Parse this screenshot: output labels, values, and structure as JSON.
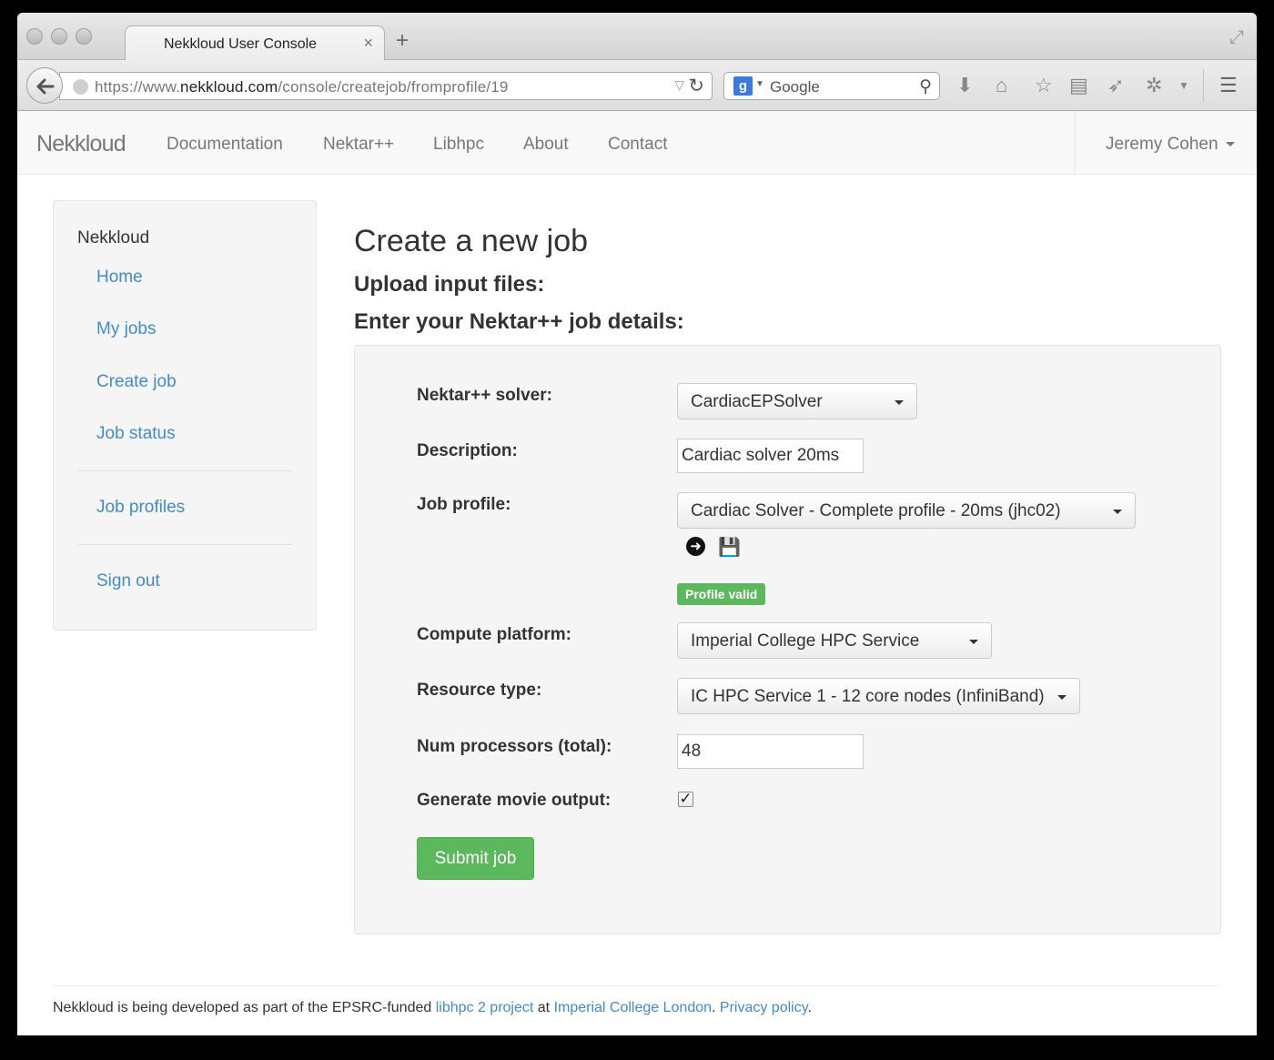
{
  "browser": {
    "tab_title": "Nekkloud User Console",
    "tab_close": "×",
    "new_tab": "+",
    "url_prefix": "https://www.",
    "url_domain": "nekkloud.com",
    "url_path": "/console/createjob/fromprofile/19",
    "search_engine_letter": "g",
    "search_placeholder": "Google"
  },
  "navbar": {
    "brand": "Nekkloud",
    "links": [
      "Documentation",
      "Nektar++",
      "Libhpc",
      "About",
      "Contact"
    ],
    "user": "Jeremy Cohen"
  },
  "sidebar": {
    "header": "Nekkloud",
    "items": [
      "Home",
      "My jobs",
      "Create job",
      "Job status",
      "Job profiles",
      "Sign out"
    ]
  },
  "main": {
    "title": "Create a new job",
    "upload_heading": "Upload input files:",
    "details_heading": "Enter your Nektar++ job details:",
    "form": {
      "solver_label": "Nektar++ solver:",
      "solver_value": "CardiacEPSolver",
      "description_label": "Description:",
      "description_value": "Cardiac solver 20ms",
      "profile_label": "Job profile:",
      "profile_value": "Cardiac Solver - Complete profile - 20ms (jhc02)",
      "profile_status": "Profile valid",
      "platform_label": "Compute platform:",
      "platform_value": "Imperial College HPC Service",
      "resource_label": "Resource type:",
      "resource_value": "IC HPC Service 1 - 12 core nodes (InfiniBand)",
      "processors_label": "Num processors (total):",
      "processors_value": "48",
      "movie_label": "Generate movie output:",
      "movie_checked": true,
      "submit_label": "Submit job"
    }
  },
  "footer": {
    "text_1": "Nekkloud is being developed as part of the EPSRC-funded ",
    "link_1": "libhpc 2 project",
    "text_2": " at ",
    "link_2": "Imperial College London",
    "text_3": ". ",
    "link_3": "Privacy policy",
    "text_4": "."
  },
  "colors": {
    "link": "#428bca",
    "success": "#5cb85c",
    "navbar_bg": "#f8f8f8",
    "well_bg": "#f5f5f5"
  }
}
